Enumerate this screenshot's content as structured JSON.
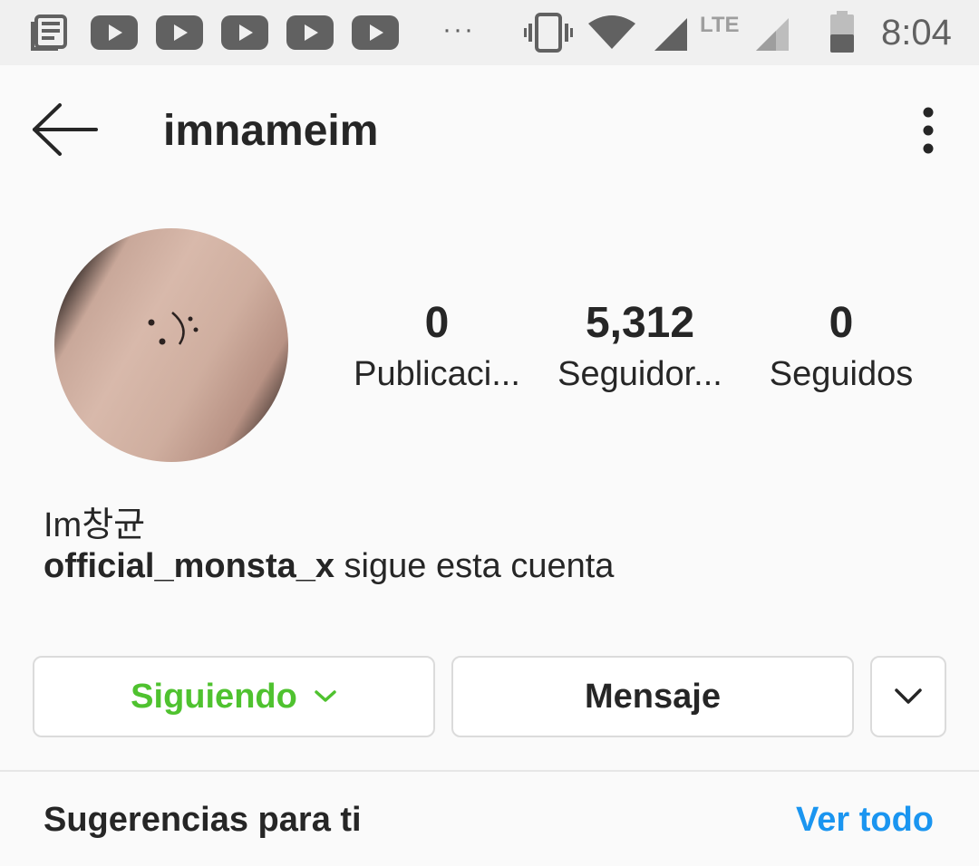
{
  "status_bar": {
    "notification_icons": [
      "news-icon",
      "youtube-icon",
      "youtube-icon",
      "youtube-icon",
      "youtube-icon",
      "youtube-icon"
    ],
    "overflow": "···",
    "network_type": "LTE",
    "time": "8:04"
  },
  "header": {
    "username": "imnameim"
  },
  "profile": {
    "stats": [
      {
        "value": "0",
        "label": "Publicaci..."
      },
      {
        "value": "5,312",
        "label": "Seguidor..."
      },
      {
        "value": "0",
        "label": "Seguidos"
      }
    ],
    "full_name": "Im창균",
    "followed_by_user": "official_monsta_x",
    "followed_by_suffix": " sigue esta cuenta"
  },
  "actions": {
    "following_label": "Siguiendo",
    "message_label": "Mensaje"
  },
  "suggestions": {
    "title": "Sugerencias para ti",
    "see_all_label": "Ver todo"
  },
  "colors": {
    "following_green": "#4fc22f",
    "link_blue": "#1a95f0",
    "text": "#262626"
  }
}
